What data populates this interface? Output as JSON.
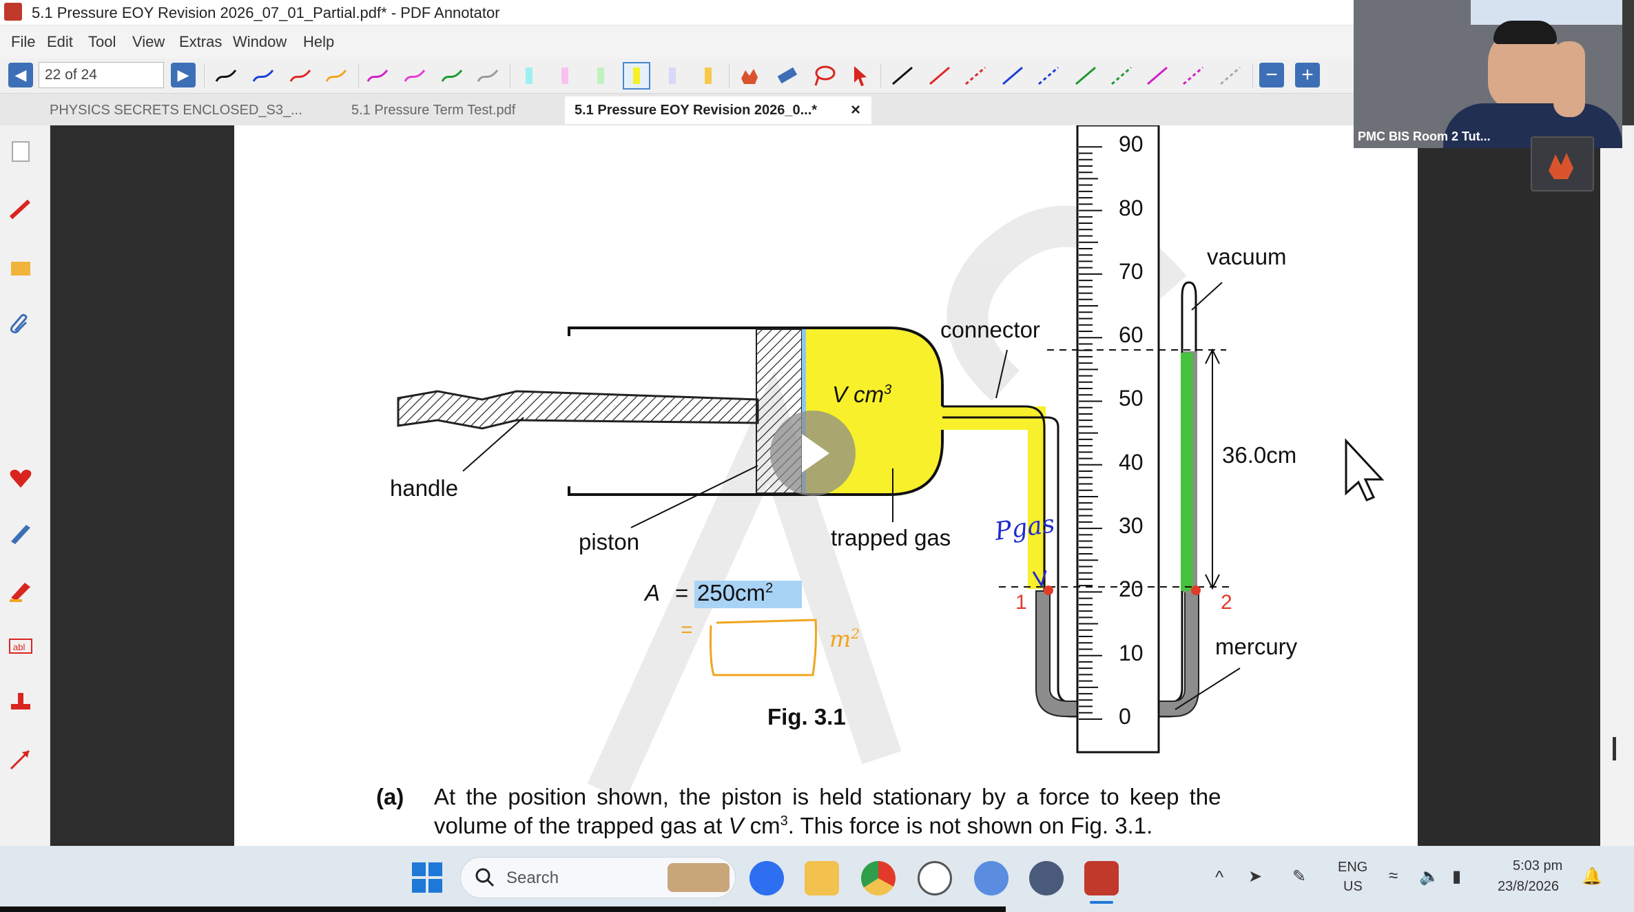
{
  "window": {
    "title": "5.1 Pressure EOY Revision 2026_07_01_Partial.pdf* - PDF Annotator"
  },
  "menu": [
    "File",
    "Edit",
    "Tool",
    "View",
    "Extras",
    "Window",
    "Help"
  ],
  "toolbar": {
    "page_indicator": "22 of 24",
    "prev_icon": "◀",
    "next_icon": "▶",
    "zoom_out_icon": "−",
    "zoom_in_icon": "+"
  },
  "tabs": [
    {
      "label": "PHYSICS SECRETS ENCLOSED_S3_...",
      "active": false
    },
    {
      "label": "5.1 Pressure Term Test.pdf",
      "active": false
    },
    {
      "label": "5.1 Pressure EOY Revision 2026_0...*",
      "active": true,
      "close": "×"
    }
  ],
  "video": {
    "participant_label": "PMC BIS Room 2 Tut..."
  },
  "figure": {
    "scale_ticks": [
      "90",
      "80",
      "70",
      "60",
      "50",
      "40",
      "30",
      "20",
      "10",
      "0"
    ],
    "labels": {
      "vacuum": "vacuum",
      "connector": "connector",
      "volume": "V cm",
      "volume_sup": "3",
      "height": "36.0cm",
      "handle": "handle",
      "piston": "piston",
      "trapped_gas": "trapped gas",
      "mercury": "mercury",
      "area_label": "A",
      "area_eq": "=",
      "area_value": "250cm",
      "area_sup": "2",
      "caption_prefix": "Fig. ",
      "caption_num": "3.1"
    },
    "annotations": {
      "pgas": "Pgas",
      "point1": "1",
      "point2": "2",
      "eq": "=",
      "unit": "m",
      "unit_sup": "2"
    }
  },
  "question": {
    "part": "(a)",
    "line1": "At the position shown, the piston is held stationary by a force to keep the",
    "line2a": "volume of the trapped gas at ",
    "line2b": "V",
    "line2c": " cm",
    "line2sup": "3",
    "line2d": ". This force is not shown on Fig. 3.1."
  },
  "taskbar": {
    "search_placeholder": "Search",
    "lang_top": "ENG",
    "lang_bottom": "US",
    "time": "5:03 pm",
    "date": "23/8/2026"
  },
  "colors": {
    "highlight_yellow": "#f7f02a",
    "mercury_gray": "#8d8d8d",
    "green_bar": "#46c23c",
    "area_highlight": "#a9d3f5",
    "annotation_blue": "#1f2bd0",
    "annotation_orange": "#f0a51e",
    "annotation_red": "#e23a2a",
    "nav_blue": "#3d6fb6"
  }
}
